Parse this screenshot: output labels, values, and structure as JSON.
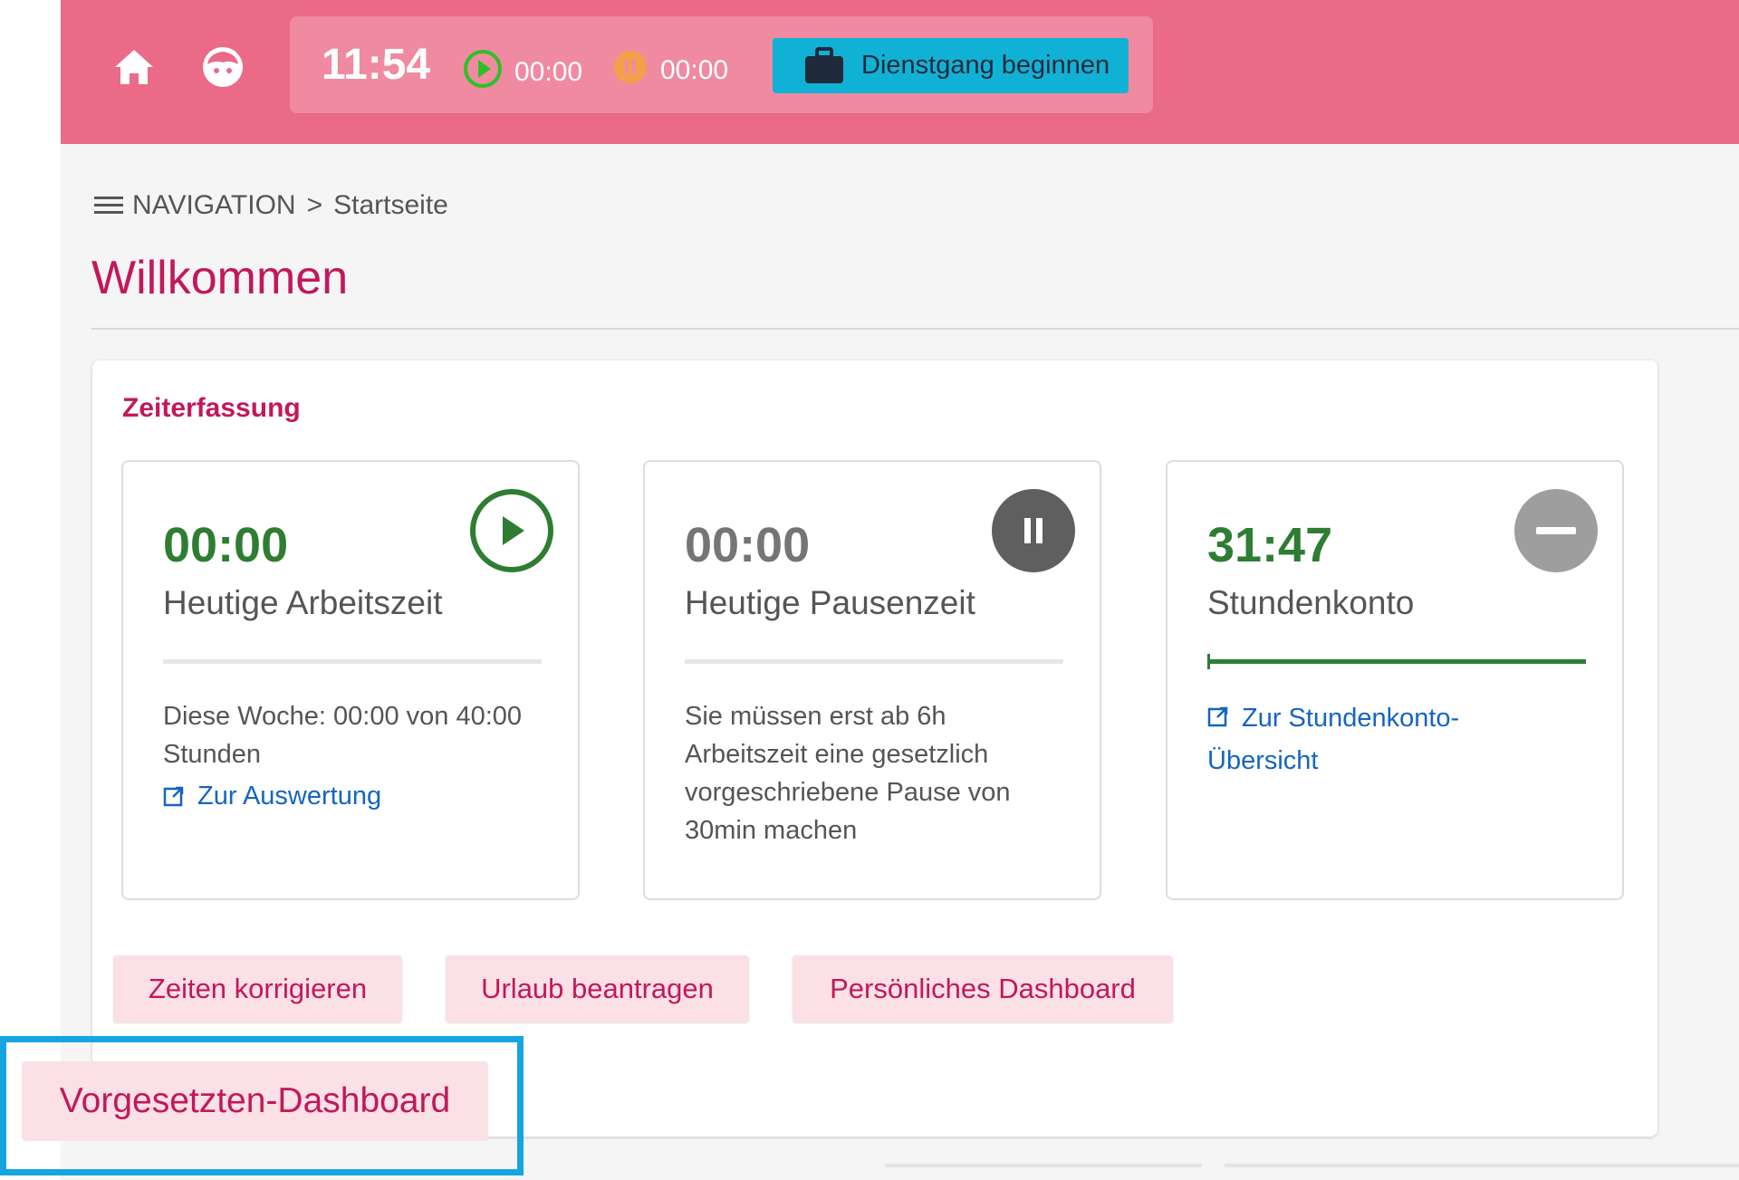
{
  "topbar": {
    "clock": "11:54",
    "work_timer": "00:00",
    "pause_timer": "00:00",
    "travel_button_label": "Dienstgang beginnen",
    "icons": [
      "home-icon",
      "face-icon",
      "play-circle-icon",
      "pause-circle-icon",
      "briefcase-icon"
    ]
  },
  "breadcrumb": {
    "nav_label": "NAVIGATION",
    "separator": ">",
    "current": "Startseite"
  },
  "page": {
    "title": "Willkommen"
  },
  "zeiterfassung": {
    "title": "Zeiterfassung",
    "tiles": [
      {
        "value": "00:00",
        "label": "Heutige Arbeitszeit",
        "desc": "Diese Woche: 00:00 von 40:00 Stunden",
        "link": "Zur Auswertung",
        "icon": "play-icon",
        "value_color": "#2e7d32"
      },
      {
        "value": "00:00",
        "label": "Heutige Pausenzeit",
        "desc": "Sie müssen erst ab 6h Arbeitszeit eine gesetzlich vorgeschriebene Pause von 30min machen",
        "icon": "pause-icon",
        "value_color": "#757575"
      },
      {
        "value": "31:47",
        "label": "Stundenkonto",
        "link": "Zur Stundenkonto-Übersicht",
        "icon": "minus-icon",
        "value_color": "#2e7d32"
      }
    ],
    "buttons": {
      "correct": "Zeiten korrigieren",
      "vacation": "Urlaub beantragen",
      "dashboard": "Persönliches Dashboard",
      "supervisor": "Vorgesetzten-Dashboard"
    }
  },
  "colors": {
    "topbar": "#ea6a87",
    "accent": "#c2185b",
    "green": "#2e7d32",
    "link": "#1565c0",
    "travel_button": "#11b1d6",
    "highlight": "#16a5e0"
  }
}
